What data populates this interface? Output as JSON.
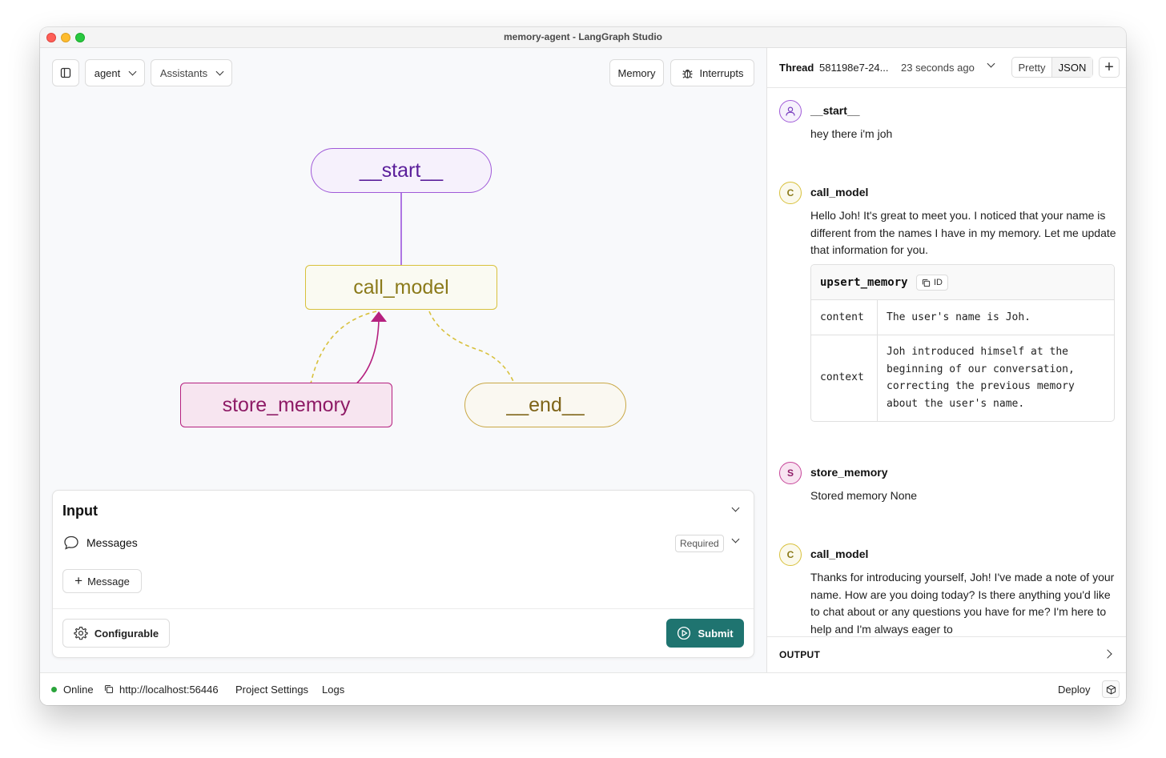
{
  "window": {
    "title": "memory-agent - LangGraph Studio"
  },
  "toolbar": {
    "graph_select": "agent",
    "assistants_select": "Assistants",
    "memory_button": "Memory",
    "interrupts_button": "Interrupts"
  },
  "graph": {
    "nodes": {
      "start": "__start__",
      "call_model": "call_model",
      "store_memory": "store_memory",
      "end": "__end__"
    }
  },
  "input_panel": {
    "title": "Input",
    "messages_label": "Messages",
    "required_badge": "Required",
    "add_message_button": "Message",
    "configurable_button": "Configurable",
    "submit_button": "Submit"
  },
  "thread": {
    "label": "Thread",
    "id": "581198e7-24...",
    "time": "23 seconds ago",
    "view_pretty": "Pretty",
    "view_json": "JSON",
    "output_label": "OUTPUT"
  },
  "messages": [
    {
      "avatar_letter": "",
      "node": "__start__",
      "text": "hey there i'm joh"
    },
    {
      "avatar_letter": "C",
      "node": "call_model",
      "text": "Hello Joh! It's great to meet you. I noticed that your name is different from the names I have in my memory. Let me update that information for you."
    },
    {
      "avatar_letter": "S",
      "node": "store_memory",
      "text": "Stored memory None"
    },
    {
      "avatar_letter": "C",
      "node": "call_model",
      "text": "Thanks for introducing yourself, Joh! I've made a note of your name. How are you doing today? Is there anything you'd like to chat about or any questions you have for me? I'm here to help and I'm always eager to"
    }
  ],
  "tool_call": {
    "name": "upsert_memory",
    "id_label": "ID",
    "rows": [
      {
        "key": "content",
        "value": "The user's name is Joh."
      },
      {
        "key": "context",
        "value": "Joh introduced himself at the beginning of our conversation, correcting the previous memory about the user's name."
      }
    ]
  },
  "statusbar": {
    "status": "Online",
    "url": "http://localhost:56446",
    "project_settings": "Project Settings",
    "logs": "Logs",
    "deploy": "Deploy"
  },
  "colors": {
    "start": "#8a44d4",
    "call_model": "#d8c13c",
    "store_memory": "#b5207f",
    "end": "#c9a845",
    "submit": "#1f7470",
    "online": "#2aa43b"
  }
}
